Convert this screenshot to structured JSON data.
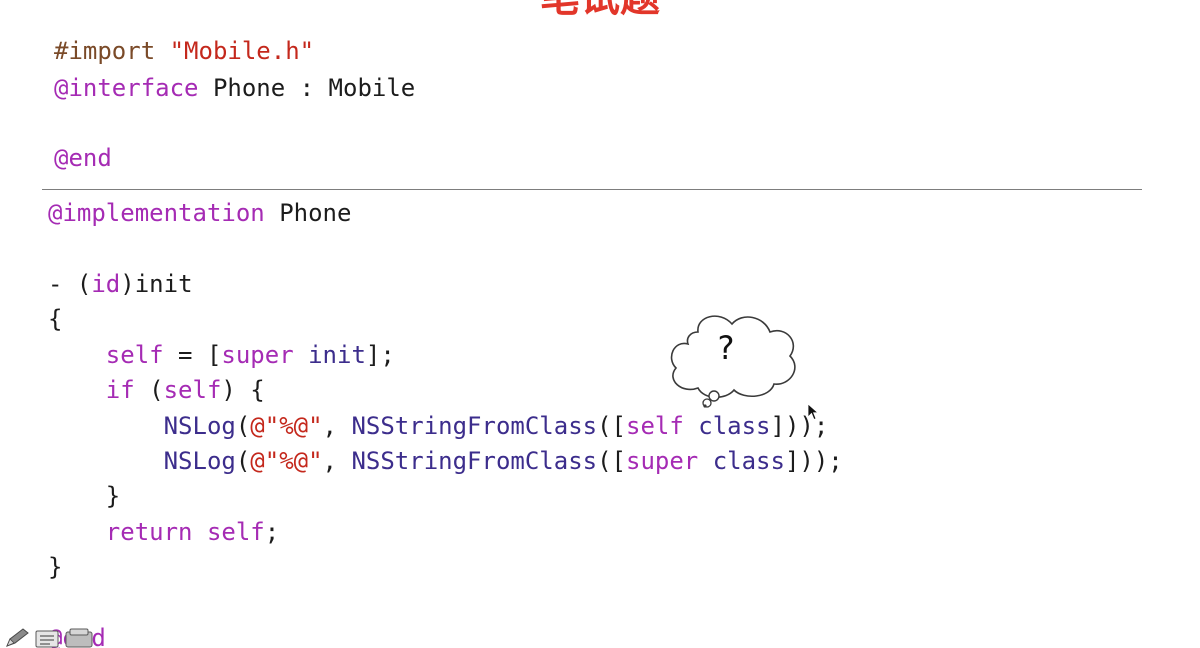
{
  "slide": {
    "title": "笔试题"
  },
  "header_code": [
    [
      {
        "t": "#import ",
        "c": "pp"
      },
      {
        "t": "\"Mobile.h\"",
        "c": "str"
      }
    ],
    [
      {
        "t": "@interface",
        "c": "kw"
      },
      {
        "t": " Phone : Mobile",
        "c": "plain"
      }
    ],
    [
      {
        "t": "@end",
        "c": "kw"
      }
    ]
  ],
  "impl_code": [
    [
      {
        "t": "@implementation",
        "c": "kw"
      },
      {
        "t": " Phone",
        "c": "plain"
      }
    ],
    [
      {
        "t": "- (",
        "c": "plain"
      },
      {
        "t": "id",
        "c": "kw"
      },
      {
        "t": ")init",
        "c": "plain"
      }
    ],
    [
      {
        "t": "{",
        "c": "plain"
      }
    ],
    [
      {
        "t": "    ",
        "c": "plain"
      },
      {
        "t": "self",
        "c": "kw"
      },
      {
        "t": " = [",
        "c": "plain"
      },
      {
        "t": "super",
        "c": "kw"
      },
      {
        "t": " ",
        "c": "plain"
      },
      {
        "t": "init",
        "c": "fn"
      },
      {
        "t": "];",
        "c": "plain"
      }
    ],
    [
      {
        "t": "    ",
        "c": "plain"
      },
      {
        "t": "if",
        "c": "kw"
      },
      {
        "t": " (",
        "c": "plain"
      },
      {
        "t": "self",
        "c": "kw"
      },
      {
        "t": ") {",
        "c": "plain"
      }
    ],
    [
      {
        "t": "        ",
        "c": "plain"
      },
      {
        "t": "NSLog",
        "c": "fn"
      },
      {
        "t": "(",
        "c": "plain"
      },
      {
        "t": "@\"%@\"",
        "c": "str"
      },
      {
        "t": ", ",
        "c": "plain"
      },
      {
        "t": "NSStringFromClass",
        "c": "fn"
      },
      {
        "t": "([",
        "c": "plain"
      },
      {
        "t": "self",
        "c": "kw"
      },
      {
        "t": " ",
        "c": "plain"
      },
      {
        "t": "class",
        "c": "fn"
      },
      {
        "t": "]));",
        "c": "plain"
      }
    ],
    [
      {
        "t": "        ",
        "c": "plain"
      },
      {
        "t": "NSLog",
        "c": "fn"
      },
      {
        "t": "(",
        "c": "plain"
      },
      {
        "t": "@\"%@\"",
        "c": "str"
      },
      {
        "t": ", ",
        "c": "plain"
      },
      {
        "t": "NSStringFromClass",
        "c": "fn"
      },
      {
        "t": "([",
        "c": "plain"
      },
      {
        "t": "super",
        "c": "kw"
      },
      {
        "t": " ",
        "c": "plain"
      },
      {
        "t": "class",
        "c": "fn"
      },
      {
        "t": "]));",
        "c": "plain"
      }
    ],
    [
      {
        "t": "    }",
        "c": "plain"
      }
    ],
    [
      {
        "t": "    ",
        "c": "plain"
      },
      {
        "t": "return",
        "c": "kw"
      },
      {
        "t": " ",
        "c": "plain"
      },
      {
        "t": "self",
        "c": "kw"
      },
      {
        "t": ";",
        "c": "plain"
      }
    ],
    [
      {
        "t": "}",
        "c": "plain"
      }
    ],
    [
      {
        "t": "@end",
        "c": "kw"
      }
    ]
  ],
  "thought_bubble": {
    "text": "?"
  },
  "toolbar": {
    "icons": [
      "pen-icon",
      "notes-icon",
      "slides-icon"
    ]
  },
  "colors": {
    "title": "#e2362a",
    "keyword": "#a52bb4",
    "preprocessor": "#7a4a28",
    "string": "#c4281c",
    "method": "#3c2d8c",
    "plain": "#1c1c1c",
    "divider": "#7d7d7d"
  }
}
